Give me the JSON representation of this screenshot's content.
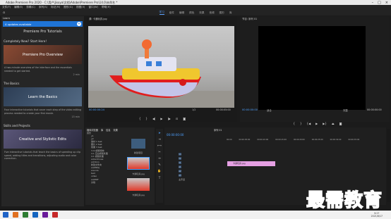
{
  "window": {
    "title": "Adobe Premiere Pro 2020 - C:\\用户\\Jisoya\\文档\\Adobe\\Premiere Pro\\14.0\\未命名 *"
  },
  "menu": [
    "文件(F)",
    "编辑(E)",
    "剪辑(C)",
    "序列(S)",
    "标记(M)",
    "图形(G)",
    "视图(V)",
    "窗口(W)",
    "帮助(H)"
  ],
  "workspaces": [
    "学习",
    "组件",
    "编辑",
    "颜色",
    "效果",
    "音频",
    "图形",
    "库"
  ],
  "learn": {
    "tab": "Learn",
    "updates": "4 updates available",
    "heading": "Premiere Pro Tutorials",
    "sections": [
      {
        "title": "Completely New? Start Here!",
        "thumb": "Premiere Pro Overview",
        "desc": "A two-minute overview of the interface and the essentials needed to get started.",
        "time": "2 min",
        "color": "#7a3b2a"
      },
      {
        "title": "The Basics",
        "thumb": "Learn the Basics",
        "desc": "Four interactive tutorials that cover each step of the video editing process needed to create your first movie.",
        "time": "15 min",
        "color": "#3a4a60"
      },
      {
        "title": "Skills and Projects",
        "thumb": "Creative and Stylistic Edits",
        "desc": "Five interactive tutorials that teach the basics of speeding up clip speed, adding titles and transitions, adjusting audio and color correction.",
        "time": "20 min",
        "color": "#4a4a6a"
      }
    ]
  },
  "source": {
    "tab": "源: 卡通玩具.jpg",
    "tc_left": "00:00:00:24",
    "tc_right": "00:00:05:00",
    "fit": "1/2"
  },
  "program": {
    "tab": "节目: 序列 01",
    "tc_left": "00:00:00:00",
    "fit": "适合",
    "tc_right": "00:00:00:00",
    "ratio": "完整"
  },
  "project": {
    "tabs": [
      "媒体浏览器",
      "库",
      "信息",
      "效果"
    ],
    "folders": [
      "音乐",
      "y1",
      "y2",
      "素材 1 test",
      "图片 2 test",
      "效果 3 test",
      "3.11视频特效",
      "4.1 空白视频处理",
      "4.1 视频处理",
      "ad/archives",
      "ad/docs",
      "新建文件夹",
      "ad/PROJ",
      "sounds",
      "test",
      "video",
      "ad/PDF",
      "文档"
    ],
    "items": [
      "新建项目",
      "卡通玩具.jpg",
      "卡通玩具.jpg"
    ]
  },
  "timeline": {
    "tab": "序列 01",
    "timecode": "00:00:00:00",
    "ruler": [
      "00:00",
      "00:00:05:00",
      "00:00:10:00",
      "00:00:15:00",
      "00:00:20:00",
      "00:00:25:00",
      "00:00:30:00",
      "00:00:35:00"
    ],
    "tracks": [
      "V3",
      "V2",
      "V1",
      "A1",
      "A2",
      "A3",
      "主声道"
    ],
    "clip": "卡通玩具.jpg"
  },
  "taskbar": {
    "time": "9:27",
    "date": "2021/6/17"
  },
  "watermark": "最需教育"
}
